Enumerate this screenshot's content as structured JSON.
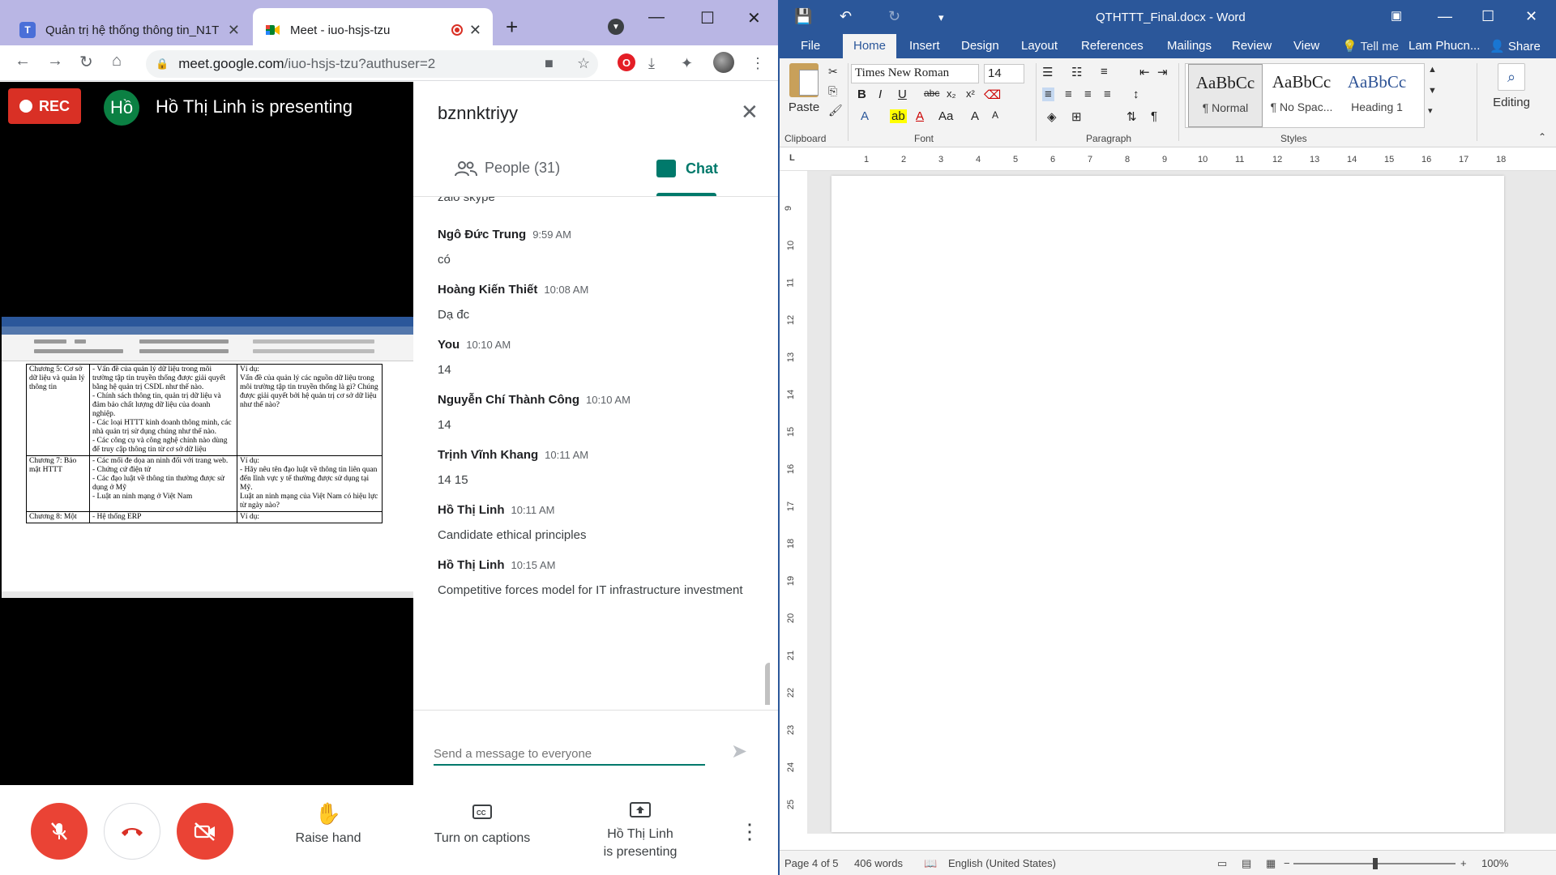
{
  "chrome": {
    "tabs": [
      {
        "title": "Quản trị hệ thống thông tin_N1T",
        "icon": "teams-icon"
      },
      {
        "title": "Meet - iuo-hsjs-tzu",
        "icon": "meet-icon",
        "recording": true
      }
    ],
    "new_tab": "+",
    "url_domain": "meet.google.com",
    "url_path": "/iuo-hsjs-tzu?authuser=2"
  },
  "meet": {
    "rec_label": "REC",
    "presenter_initials": "Hồ",
    "presenter_title": "Hồ Thị Linh is presenting",
    "meeting_code": "bznnktriyy",
    "tabs": {
      "people": "People (31)",
      "chat": "Chat"
    },
    "cut_off_text": "zalo skype",
    "messages": [
      {
        "sender": "Ngô Đức Trung",
        "time": "9:59 AM",
        "text": "có"
      },
      {
        "sender": "Hoàng Kiến Thiết",
        "time": "10:08 AM",
        "text": "Dạ đc"
      },
      {
        "sender": "You",
        "time": "10:10 AM",
        "text": "14"
      },
      {
        "sender": "Nguyễn Chí Thành Công",
        "time": "10:10 AM",
        "text": "14"
      },
      {
        "sender": "Trịnh Vĩnh Khang",
        "time": "10:11 AM",
        "text": "14 15"
      },
      {
        "sender": "Hồ Thị Linh",
        "time": "10:11 AM",
        "text": "Candidate ethical principles"
      },
      {
        "sender": "Hồ Thị Linh",
        "time": "10:15 AM",
        "text": "Competitive forces model for IT infrastructure investment"
      }
    ],
    "chat_placeholder": "Send a message to everyone",
    "controls": {
      "raise_hand": "Raise hand",
      "captions": "Turn on captions",
      "presenting_line1": "Hồ Thị Linh",
      "presenting_line2": "is presenting"
    }
  },
  "shared_doc": {
    "rows": [
      {
        "col1": "Chương 5: Cơ sở dữ liệu và quản lý thông tin",
        "col2": "- Vấn đề của quản lý dữ liệu trong môi trường tập tin truyền thống được giải quyết bằng hệ quản trị CSDL như thế nào.\n- Chính sách thông tin, quản trị dữ liệu và đảm bảo chất lượng dữ liệu của doanh nghiệp.\n- Các loại HTTT kinh doanh thông minh, các nhà quản trị sử dụng chúng như thế nào.\n- Các công cụ và công nghệ chính nào dùng để truy cập thông tin từ cơ sở dữ liệu",
        "col3": "Ví dụ:\nVấn đề của quản lý các nguồn dữ liệu trong môi trường tập tin truyền thống là gì? Chúng được giải quyết bởi hệ quản trị cơ sở dữ liệu như thế nào?"
      },
      {
        "col1": "Chương 7: Bảo mật HTTT",
        "col2": "- Các mối đe dọa an ninh đối với trang web.\n- Chứng cứ điện tử\n- Các đạo luật về thông tin thường được sử dụng ở Mỹ\n- Luật an ninh mạng ở Việt Nam",
        "col3": "Ví dụ:\n- Hãy nêu tên đạo luật về thông tin liên quan đến lĩnh vực y tế thường được sử dụng tại Mỹ.\nLuật an ninh mạng của Việt Nam có hiệu lực từ ngày nào?"
      },
      {
        "col1": "Chương 8: Một",
        "col2": "- Hệ thống ERP",
        "col3": "Ví dụ:"
      }
    ]
  },
  "word": {
    "doc_title": "QTHTTT_Final.docx - Word",
    "tabs": [
      "File",
      "Home",
      "Insert",
      "Design",
      "Layout",
      "References",
      "Mailings",
      "Review",
      "View",
      "Tell me",
      "Lam Phucn...",
      "Share"
    ],
    "clipboard": {
      "paste": "Paste",
      "label": "Clipboard"
    },
    "font": {
      "name": "Times New Roman",
      "size": "14",
      "label": "Font"
    },
    "paragraph_label": "Paragraph",
    "styles": [
      {
        "sample": "AaBbCc",
        "name": "¶ Normal"
      },
      {
        "sample": "AaBbCc",
        "name": "¶ No Spac..."
      },
      {
        "sample": "AaBbCc",
        "name": "Heading 1"
      }
    ],
    "styles_label": "Styles",
    "editing": "Editing",
    "ruler_numbers": [
      "1",
      "2",
      "3",
      "4",
      "5",
      "6",
      "7",
      "8",
      "9",
      "10",
      "11",
      "12",
      "13",
      "14",
      "15",
      "16",
      "17",
      "18"
    ],
    "vruler_numbers": [
      "9",
      "10",
      "11",
      "12",
      "13",
      "14",
      "15",
      "16",
      "17",
      "18",
      "19",
      "20",
      "21",
      "22",
      "23",
      "24",
      "25"
    ],
    "status": {
      "page": "Page 4 of 5",
      "words": "406 words",
      "language": "English (United States)",
      "zoom": "100%"
    }
  }
}
